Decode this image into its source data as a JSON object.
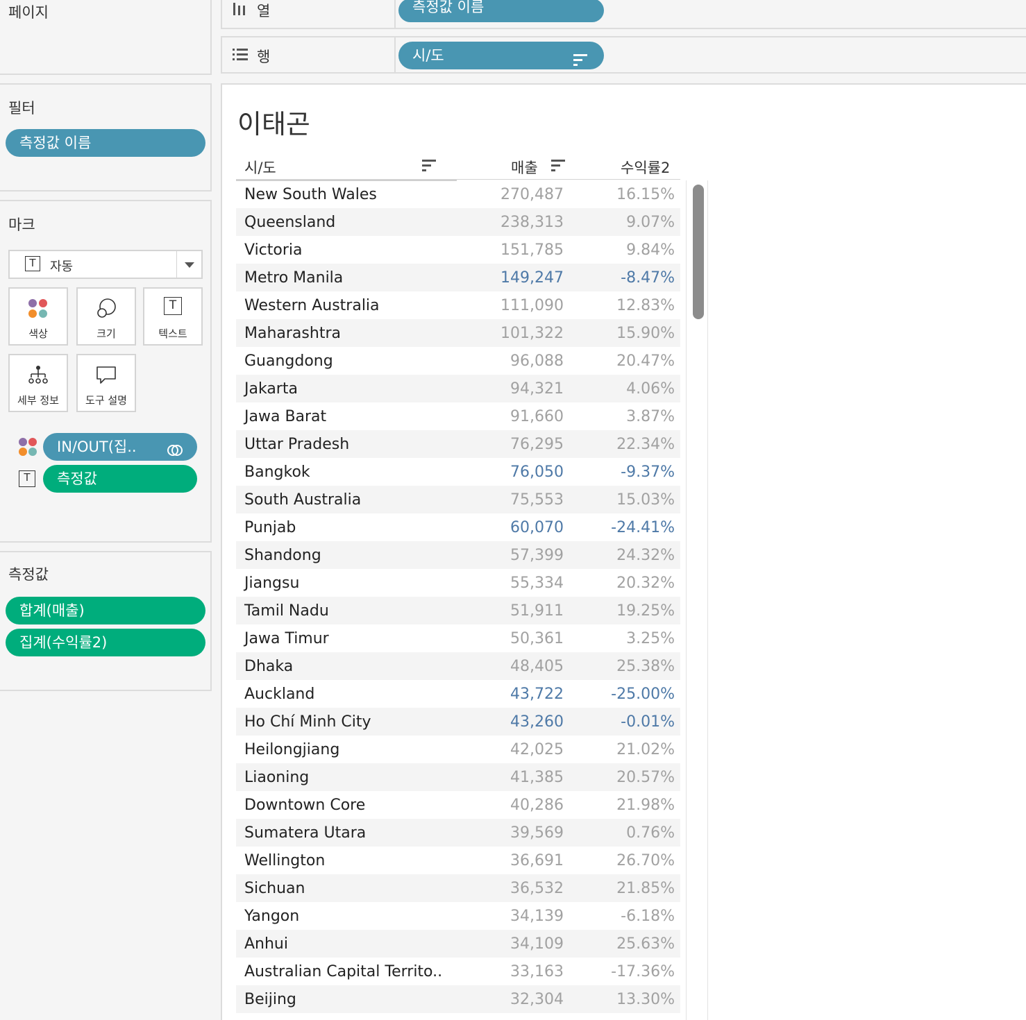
{
  "pages_card": {
    "title": "페이지"
  },
  "filters_card": {
    "title": "필터",
    "pill": "측정값 이름"
  },
  "marks_card": {
    "title": "마크",
    "mark_type": "자동",
    "buttons": {
      "color": "색상",
      "size": "크기",
      "text": "텍스트",
      "detail": "세부 정보",
      "tooltip": "도구 설명"
    },
    "color_field": "IN/OUT(집..",
    "text_field": "측정값",
    "text_icon": "T"
  },
  "measures_card": {
    "title": "측정값",
    "items": [
      "합계(매출)",
      "집계(수익률2)"
    ]
  },
  "shelves": {
    "columns": {
      "label": "열",
      "pill": "측정값 이름"
    },
    "rows": {
      "label": "행",
      "pill": "시/도"
    }
  },
  "view": {
    "title": "이태곤",
    "headers": {
      "region": "시/도",
      "sales": "매출",
      "profit": "수익률2"
    },
    "rows": [
      {
        "region": "New South Wales",
        "sales": "270,487",
        "profit": "16.15%",
        "out": false
      },
      {
        "region": "Queensland",
        "sales": "238,313",
        "profit": "9.07%",
        "out": false
      },
      {
        "region": "Victoria",
        "sales": "151,785",
        "profit": "9.84%",
        "out": false
      },
      {
        "region": "Metro Manila",
        "sales": "149,247",
        "profit": "-8.47%",
        "out": true
      },
      {
        "region": "Western Australia",
        "sales": "111,090",
        "profit": "12.83%",
        "out": false
      },
      {
        "region": "Maharashtra",
        "sales": "101,322",
        "profit": "15.90%",
        "out": false
      },
      {
        "region": "Guangdong",
        "sales": "96,088",
        "profit": "20.47%",
        "out": false
      },
      {
        "region": "Jakarta",
        "sales": "94,321",
        "profit": "4.06%",
        "out": false
      },
      {
        "region": "Jawa Barat",
        "sales": "91,660",
        "profit": "3.87%",
        "out": false
      },
      {
        "region": "Uttar Pradesh",
        "sales": "76,295",
        "profit": "22.34%",
        "out": false
      },
      {
        "region": "Bangkok",
        "sales": "76,050",
        "profit": "-9.37%",
        "out": true
      },
      {
        "region": "South Australia",
        "sales": "75,553",
        "profit": "15.03%",
        "out": false
      },
      {
        "region": "Punjab",
        "sales": "60,070",
        "profit": "-24.41%",
        "out": true
      },
      {
        "region": "Shandong",
        "sales": "57,399",
        "profit": "24.32%",
        "out": false
      },
      {
        "region": "Jiangsu",
        "sales": "55,334",
        "profit": "20.32%",
        "out": false
      },
      {
        "region": "Tamil Nadu",
        "sales": "51,911",
        "profit": "19.25%",
        "out": false
      },
      {
        "region": "Jawa Timur",
        "sales": "50,361",
        "profit": "3.25%",
        "out": false
      },
      {
        "region": "Dhaka",
        "sales": "48,405",
        "profit": "25.38%",
        "out": false
      },
      {
        "region": "Auckland",
        "sales": "43,722",
        "profit": "-25.00%",
        "out": true
      },
      {
        "region": "Ho Chí Minh City",
        "sales": "43,260",
        "profit": "-0.01%",
        "out": true
      },
      {
        "region": "Heilongjiang",
        "sales": "42,025",
        "profit": "21.02%",
        "out": false
      },
      {
        "region": "Liaoning",
        "sales": "41,385",
        "profit": "20.57%",
        "out": false
      },
      {
        "region": "Downtown Core",
        "sales": "40,286",
        "profit": "21.98%",
        "out": false
      },
      {
        "region": "Sumatera Utara",
        "sales": "39,569",
        "profit": "0.76%",
        "out": false
      },
      {
        "region": "Wellington",
        "sales": "36,691",
        "profit": "26.70%",
        "out": false
      },
      {
        "region": "Sichuan",
        "sales": "36,532",
        "profit": "21.85%",
        "out": false
      },
      {
        "region": "Yangon",
        "sales": "34,139",
        "profit": "-6.18%",
        "out": false
      },
      {
        "region": "Anhui",
        "sales": "34,109",
        "profit": "25.63%",
        "out": false
      },
      {
        "region": "Australian Capital Territo..",
        "sales": "33,163",
        "profit": "-17.36%",
        "out": false
      },
      {
        "region": "Beijing",
        "sales": "32,304",
        "profit": "13.30%",
        "out": false
      }
    ]
  },
  "colors": {
    "pill_blue": "#4996b2",
    "pill_green": "#00ad7c",
    "out_blue": "#4e79a7",
    "in_gray": "#a1a1a1"
  }
}
